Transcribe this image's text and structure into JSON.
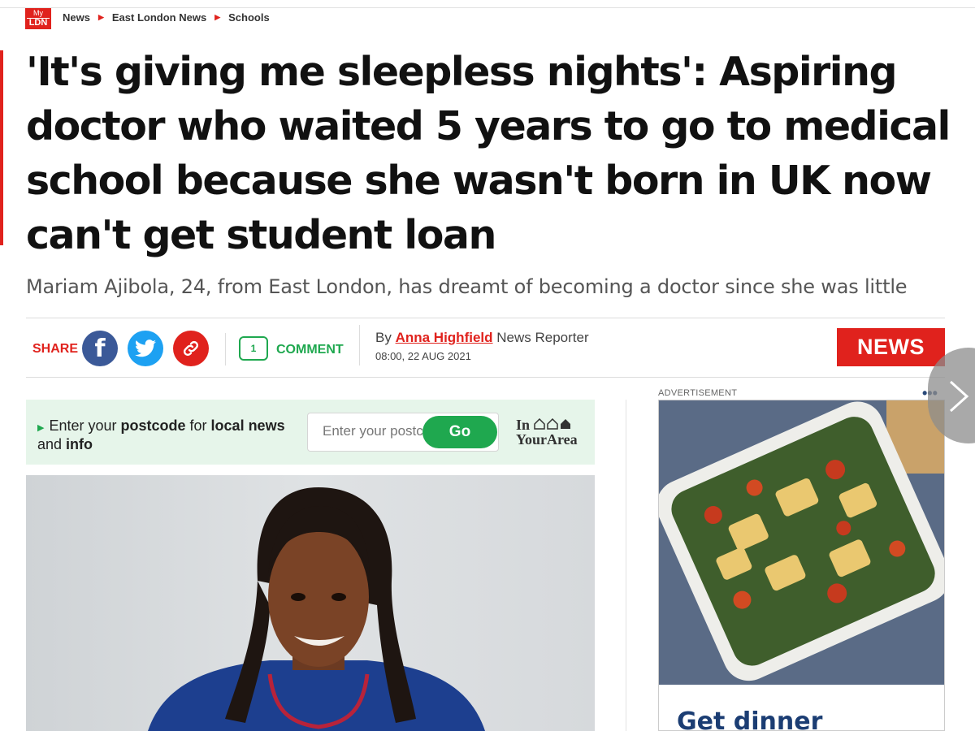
{
  "logo": {
    "top": "My",
    "bottom": "LDN"
  },
  "breadcrumb": [
    {
      "label": "News"
    },
    {
      "label": "East London News"
    },
    {
      "label": "Schools"
    }
  ],
  "headline": "'It's giving me sleepless nights': Aspiring doctor who waited 5 years to go to medical school because she wasn't born in UK now can't get student loan",
  "standfirst": "Mariam Ajibola, 24, from East London, has dreamt of becoming a doctor since she was little",
  "share": {
    "label": "SHARE",
    "facebook_letter": "f"
  },
  "comments": {
    "count": "1",
    "label": "COMMENT"
  },
  "byline": {
    "prefix": "By",
    "author": "Anna Highfield",
    "role": "News Reporter",
    "date": "08:00, 22 AUG 2021"
  },
  "section_badge": "NEWS",
  "postcode": {
    "text_pre": "Enter your ",
    "text_b1": "postcode",
    "text_mid": " for ",
    "text_b2": "local news",
    "text_and": "and ",
    "text_b3": "info",
    "placeholder": "Enter your postcode",
    "button": "Go",
    "brand_top": "In",
    "brand_bottom": "YourArea"
  },
  "advert": {
    "label": "ADVERTISEMENT",
    "dots": "•••",
    "headline": "Get dinner"
  },
  "colors": {
    "brand_red": "#e0221d",
    "green": "#1fa84f",
    "facebook": "#3b5998",
    "twitter": "#1da1f2",
    "ad_blue": "#1b3d73"
  }
}
